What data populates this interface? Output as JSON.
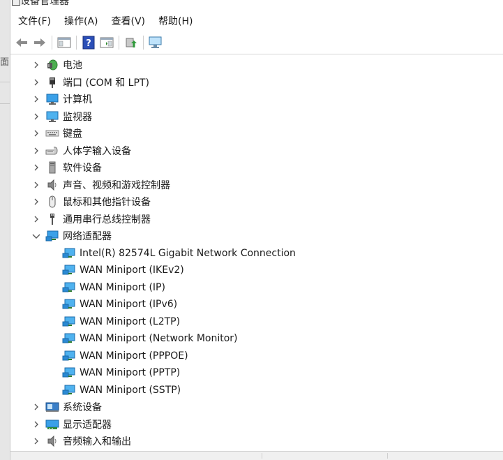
{
  "window": {
    "title": "设备管理器"
  },
  "left_strip": {
    "fragments": [
      "面"
    ]
  },
  "menu": [
    {
      "label": "文件(F)"
    },
    {
      "label": "操作(A)"
    },
    {
      "label": "查看(V)"
    },
    {
      "label": "帮助(H)"
    }
  ],
  "toolbar": {
    "buttons": [
      "back-arrow-icon",
      "forward-arrow-icon",
      "properties-icon",
      "help-icon",
      "console-tree-icon",
      "update-driver-icon",
      "monitor-scan-icon"
    ]
  },
  "tree": {
    "categories": [
      {
        "label": "电池",
        "icon": "battery-icon",
        "expanded": false
      },
      {
        "label": "端口 (COM 和 LPT)",
        "icon": "port-icon",
        "expanded": false
      },
      {
        "label": "计算机",
        "icon": "computer-icon",
        "expanded": false
      },
      {
        "label": "监视器",
        "icon": "monitor-icon",
        "expanded": false
      },
      {
        "label": "键盘",
        "icon": "keyboard-icon",
        "expanded": false
      },
      {
        "label": "人体学输入设备",
        "icon": "hid-icon",
        "expanded": false
      },
      {
        "label": "软件设备",
        "icon": "software-device-icon",
        "expanded": false
      },
      {
        "label": "声音、视频和游戏控制器",
        "icon": "speaker-icon",
        "expanded": false
      },
      {
        "label": "鼠标和其他指针设备",
        "icon": "mouse-icon",
        "expanded": false
      },
      {
        "label": "通用串行总线控制器",
        "icon": "usb-icon",
        "expanded": false
      },
      {
        "label": "网络适配器",
        "icon": "network-adapter-icon",
        "expanded": true,
        "children": [
          {
            "label": "Intel(R) 82574L Gigabit Network Connection"
          },
          {
            "label": "WAN Miniport (IKEv2)"
          },
          {
            "label": "WAN Miniport (IP)"
          },
          {
            "label": "WAN Miniport (IPv6)"
          },
          {
            "label": "WAN Miniport (L2TP)"
          },
          {
            "label": "WAN Miniport (Network Monitor)"
          },
          {
            "label": "WAN Miniport (PPPOE)"
          },
          {
            "label": "WAN Miniport (PPTP)"
          },
          {
            "label": "WAN Miniport (SSTP)"
          }
        ]
      },
      {
        "label": "系统设备",
        "icon": "system-device-icon",
        "expanded": false
      },
      {
        "label": "显示适配器",
        "icon": "display-adapter-icon",
        "expanded": false
      },
      {
        "label": "音频输入和输出",
        "icon": "audio-io-icon",
        "expanded": false
      }
    ]
  },
  "colors": {
    "network_icon": "#2a8ad4",
    "monitor_icon": "#3aa0e8",
    "chevron": "#555555"
  }
}
